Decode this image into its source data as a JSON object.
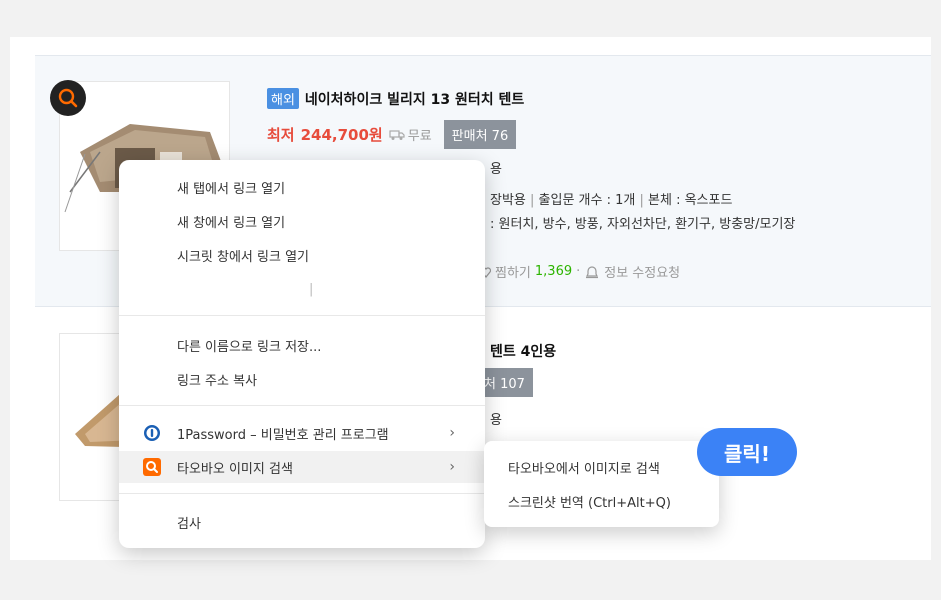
{
  "product1": {
    "badge": "해외",
    "title": "네이처하이크 빌리지 13 원터치 텐트",
    "price_label": "최저",
    "price_value": "244,700원",
    "shipping": "무료",
    "seller": "판매처 76",
    "line3": "용",
    "line4a": "장박용",
    "line4b": "출입문 개수 : 1개",
    "line4c": "본체 : 옥스포드",
    "line5": ": 원터치, 방수, 방풍, 자외선차단, 환기구, 방충망/모기장",
    "wishlist_label": "찜하기",
    "wishlist_count": "1,369",
    "report": "정보 수정요청"
  },
  "product2": {
    "title_partial": "텐트 4인용",
    "seller_partial": "처 107",
    "line3": "용"
  },
  "context_menu": {
    "items": [
      {
        "label": "새 탭에서 링크 열기"
      },
      {
        "label": "새 창에서 링크 열기"
      },
      {
        "label": "시크릿 창에서 링크 열기"
      },
      {
        "label": "다른 이름으로 링크 저장..."
      },
      {
        "label": "링크 주소 복사"
      },
      {
        "label": "1Password – 비밀번호 관리 프로그램"
      },
      {
        "label": "타오바오 이미지 검색"
      },
      {
        "label": "검사"
      }
    ],
    "divider_mark": "|",
    "submenu_arrow": "›"
  },
  "submenu": {
    "items": [
      {
        "label": "타오바오에서 이미지로 검색"
      },
      {
        "label": "스크린샷 번역 (Ctrl+Alt+Q)"
      }
    ]
  },
  "bubble": {
    "label": "클릭!"
  },
  "colors": {
    "accent": "#3b82f6",
    "price": "#e74c3c",
    "taobao": "#ff6a00"
  }
}
